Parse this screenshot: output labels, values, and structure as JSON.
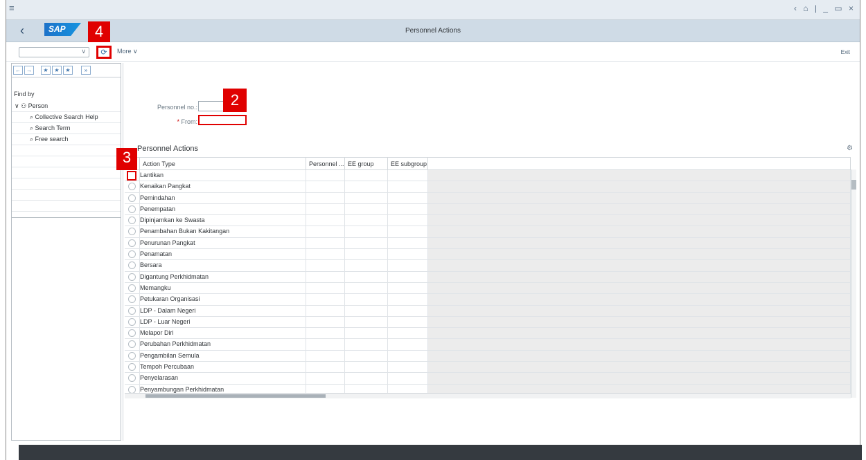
{
  "window": {
    "title": "Personnel Actions",
    "controls": "‹ ⌂ | _ ▭ ×"
  },
  "shell": {
    "back": "‹",
    "logo": "SAP"
  },
  "toolbar": {
    "tcode_value": "",
    "more_label": "More ∨",
    "exit_label": "Exit"
  },
  "nav": {
    "find_by": "Find by",
    "tree": [
      {
        "label": "Person",
        "icon": "person-icon",
        "expanded": true
      },
      {
        "label": "Collective Search Help",
        "icon": "search-icon"
      },
      {
        "label": "Search Term",
        "icon": "search-icon"
      },
      {
        "label": "Free search",
        "icon": "search-icon"
      }
    ]
  },
  "form": {
    "personnel_no_label": "Personnel no.:",
    "from_label": "From:",
    "personnel_no_value": "",
    "from_value": ""
  },
  "section": {
    "title": "Personnel Actions"
  },
  "grid": {
    "columns": [
      "Action Type",
      "Personnel ...",
      "EE group",
      "EE subgroup"
    ],
    "rows": [
      "Lantikan",
      "Kenaikan Pangkat",
      "Pemindahan",
      "Penempatan",
      "Dipinjamkan ke Swasta",
      "Penambahan Bukan Kakitangan",
      "Penurunan Pangkat",
      "Penamatan",
      "Bersara",
      "Digantung Perkhidmatan",
      "Memangku",
      "Petukaran Organisasi",
      "LDP - Dalam Negeri",
      "LDP - Luar Negeri",
      "Melapor Diri",
      "Perubahan Perkhidmatan",
      "Pengambilan Semula",
      "Tempoh Percubaan",
      "Penyelarasan",
      "Penyambungan Perkhidmatan"
    ]
  },
  "callouts": {
    "step2": "2",
    "step3": "3",
    "step4": "4"
  },
  "colors": {
    "shell": "#cfdbe6",
    "callout": "#e00000",
    "footer": "#353a40"
  }
}
